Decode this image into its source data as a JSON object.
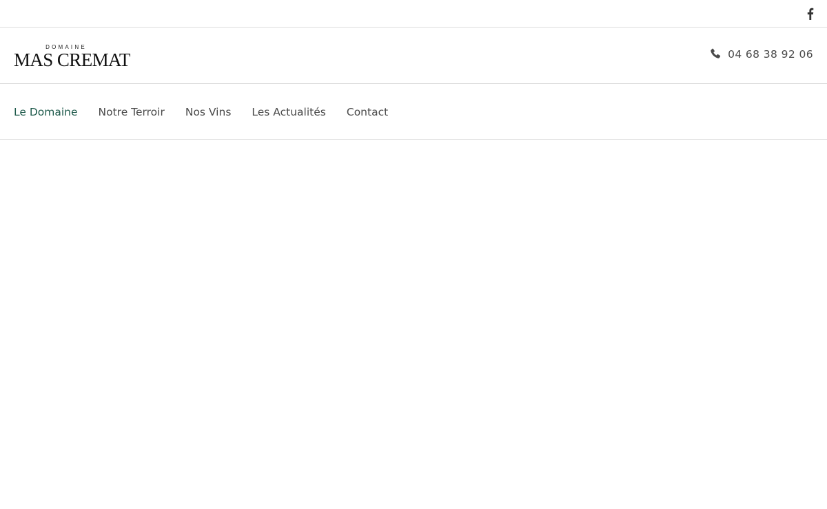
{
  "topbar": {
    "social": [
      {
        "name": "facebook",
        "icon": "facebook-icon"
      }
    ]
  },
  "header": {
    "logo": {
      "small": "DOMAINE",
      "big": "MAS CREMAT"
    },
    "phone": {
      "icon": "phone-icon",
      "number": "04 68 38 92 06"
    }
  },
  "nav": {
    "items": [
      {
        "label": "Le Domaine",
        "active": true
      },
      {
        "label": "Notre Terroir",
        "active": false
      },
      {
        "label": "Nos Vins",
        "active": false
      },
      {
        "label": "Les Actualités",
        "active": false
      },
      {
        "label": "Contact",
        "active": false
      }
    ]
  },
  "colors": {
    "accent": "#1e5a4b",
    "text": "#4a4a4a",
    "divider": "#dcdcdc"
  }
}
